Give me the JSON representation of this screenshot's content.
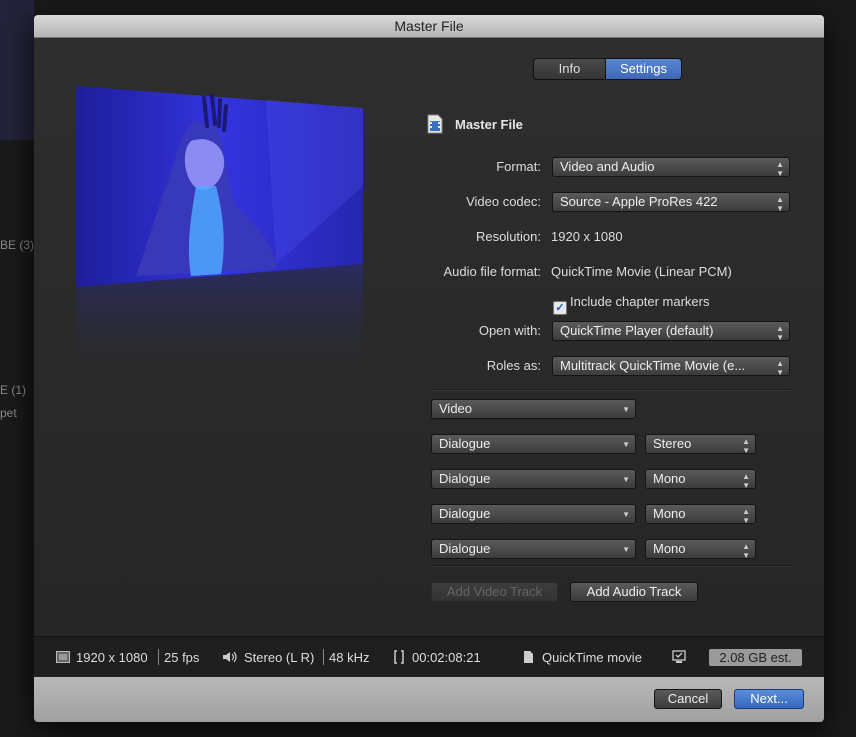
{
  "background": {
    "fragments": [
      "BE (3)",
      "E (1)",
      "pet"
    ]
  },
  "dialog": {
    "title": "Master File",
    "tabs": [
      {
        "label": "Info",
        "selected": false
      },
      {
        "label": "Settings",
        "selected": true
      }
    ],
    "header": {
      "icon": "film-document-icon",
      "title": "Master File"
    },
    "settings": {
      "format": {
        "label": "Format:",
        "value": "Video and Audio"
      },
      "video_codec": {
        "label": "Video codec:",
        "value": "Source - Apple ProRes 422"
      },
      "resolution": {
        "label": "Resolution:",
        "value": "1920 x 1080"
      },
      "audio_file_format": {
        "label": "Audio file format:",
        "value": "QuickTime Movie (Linear PCM)"
      },
      "chapter_markers": {
        "label": "Include chapter markers",
        "checked": true
      },
      "open_with": {
        "label": "Open with:",
        "value": "QuickTime Player (default)"
      },
      "roles_as": {
        "label": "Roles as:",
        "value": "Multitrack QuickTime Movie (e..."
      }
    },
    "tracks": [
      {
        "role": "Video",
        "channels": ""
      },
      {
        "role": "Dialogue",
        "channels": "Stereo"
      },
      {
        "role": "Dialogue",
        "channels": "Mono"
      },
      {
        "role": "Dialogue",
        "channels": "Mono"
      },
      {
        "role": "Dialogue",
        "channels": "Mono"
      }
    ],
    "add_video_track": {
      "label": "Add Video Track",
      "enabled": false
    },
    "add_audio_track": {
      "label": "Add Audio Track",
      "enabled": true
    },
    "status_bar": {
      "resolution": "1920 x 1080",
      "fps": "25 fps",
      "audio": "Stereo (L R)",
      "sample_rate": "48 kHz",
      "duration": "00:02:08:21",
      "file_type": "QuickTime movie",
      "size_estimate": "2.08 GB est."
    },
    "buttons": {
      "cancel": "Cancel",
      "next": "Next..."
    }
  },
  "colors": {
    "accent": "#3d68b6",
    "preview_tint": "#2a2ad0"
  }
}
